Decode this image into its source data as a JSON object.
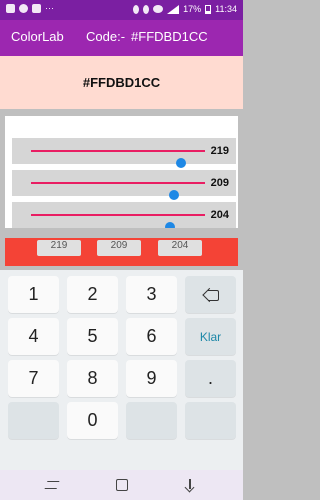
{
  "status_bar": {
    "battery": "17%",
    "time": "11:34"
  },
  "app_bar": {
    "title": "ColorLab",
    "code_label": "Code:-",
    "code_value": "#FFDBD1CC"
  },
  "preview": {
    "hex": "#FFDBD1CC",
    "color": "#ffdbd1"
  },
  "sliders": [
    {
      "value": "219",
      "fraction": 0.86
    },
    {
      "value": "209",
      "fraction": 0.82
    },
    {
      "value": "204",
      "fraction": 0.8
    }
  ],
  "chips": [
    "219",
    "209",
    "204"
  ],
  "keyboard": {
    "row1": [
      "1",
      "2",
      "3"
    ],
    "row2": [
      "4",
      "5",
      "6"
    ],
    "row3": [
      "7",
      "8",
      "9"
    ],
    "row4": [
      "0"
    ],
    "action_label": "Klar",
    "dot": "."
  },
  "colors": {
    "status_bar": "#7b1fa2",
    "app_bar": "#9c27b0",
    "slider_track": "#e91e63",
    "slider_thumb": "#1e88e5",
    "red_band": "#f44336"
  }
}
